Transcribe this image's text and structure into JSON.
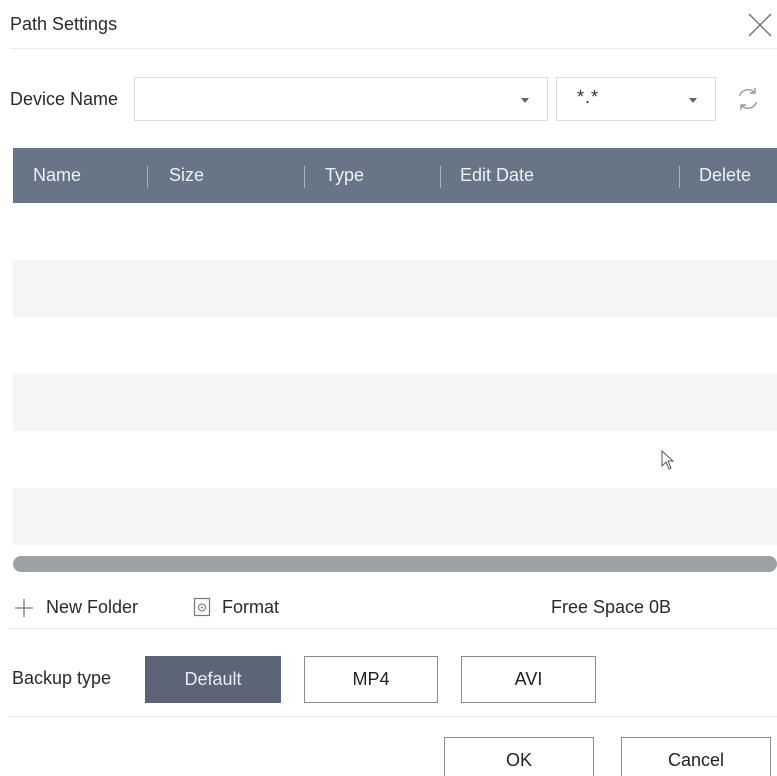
{
  "dialog": {
    "title": "Path Settings"
  },
  "device": {
    "label": "Device Name",
    "selected_value": "",
    "filter_value": "*.*"
  },
  "table": {
    "columns": [
      "Name",
      "Size",
      "Type",
      "Edit Date",
      "Delete"
    ],
    "rows": []
  },
  "tools": {
    "new_folder": "New Folder",
    "format": "Format",
    "free_space": "Free Space 0B"
  },
  "backup": {
    "label": "Backup type",
    "options": [
      "Default",
      "MP4",
      "AVI"
    ],
    "selected": "Default"
  },
  "footer": {
    "ok": "OK",
    "cancel": "Cancel"
  },
  "colors": {
    "header_bg": "#677587",
    "active_button": "#5b6577",
    "scrollbar": "#9da0a4"
  }
}
